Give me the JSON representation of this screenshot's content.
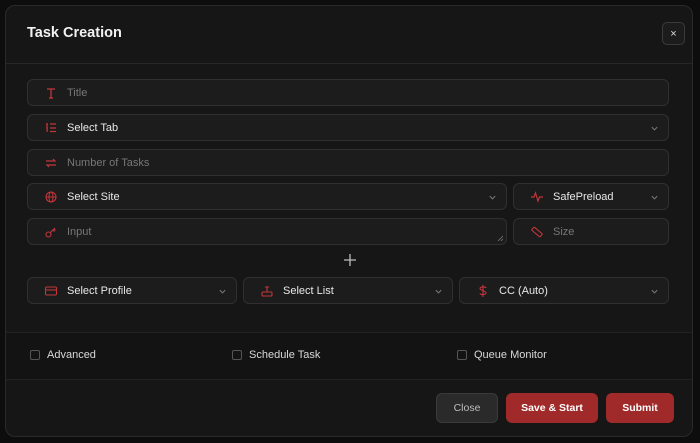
{
  "dialog": {
    "title": "Task Creation",
    "close_glyph": "×"
  },
  "fields": {
    "title_placeholder": "Title",
    "tab_value": "Select Tab",
    "num_tasks_placeholder": "Number of Tasks",
    "site_value": "Select Site",
    "mode_value": "SafePreload",
    "input_placeholder": "Input",
    "size_placeholder": "Size",
    "profile_value": "Select Profile",
    "list_value": "Select List",
    "payment_value": "CC (Auto)"
  },
  "options": {
    "advanced_label": "Advanced",
    "schedule_label": "Schedule Task",
    "queue_label": "Queue Monitor"
  },
  "footer": {
    "close_label": "Close",
    "save_start_label": "Save & Start",
    "submit_label": "Submit"
  },
  "colors": {
    "accent": "#a02a2a",
    "icon": "#c2363a"
  }
}
